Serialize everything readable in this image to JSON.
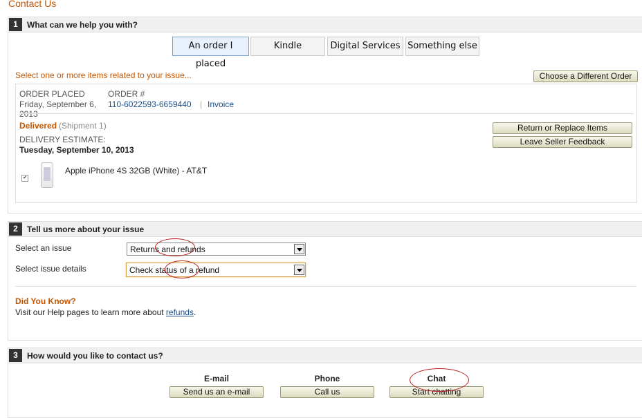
{
  "page_title": "Contact Us",
  "section1": {
    "number": "1",
    "label": "What can we help you with?",
    "tabs": [
      "An order I placed",
      "Kindle",
      "Digital Services",
      "Something else"
    ],
    "select_items_text": "Select one or more items related to your issue...",
    "choose_order_button": "Choose a Different Order",
    "order": {
      "placed_label": "ORDER PLACED",
      "placed_date_line1": "Friday, September 6,",
      "placed_date_line2": "2013",
      "number_label": "ORDER #",
      "number": "110-6022593-6659440",
      "separator": "|",
      "invoice": "Invoice",
      "status": "Delivered",
      "shipment": "(Shipment 1)",
      "delivery_label": "DELIVERY ESTIMATE:",
      "delivery_date": "Tuesday, September 10, 2013",
      "item_name": "Apple iPhone 4S 32GB (White) - AT&T",
      "return_button": "Return or Replace Items",
      "feedback_button": "Leave Seller Feedback"
    }
  },
  "section2": {
    "number": "2",
    "label": "Tell us more about your issue",
    "issue_label": "Select an issue",
    "issue_value": "Returns and refunds",
    "details_label": "Select issue details",
    "details_value": "Check status of a refund",
    "did_you_know_title": "Did You Know?",
    "help_text_prefix": "Visit our Help pages to learn more about ",
    "help_link": "refunds",
    "help_text_suffix": "."
  },
  "section3": {
    "number": "3",
    "label": "How would you like to contact us?",
    "email_title": "E-mail",
    "email_button": "Send us an e-mail",
    "phone_title": "Phone",
    "phone_button": "Call us",
    "chat_title": "Chat",
    "chat_button": "Start chatting"
  },
  "colors": {
    "accent_orange": "#c45500",
    "link_blue": "#1b4f8a",
    "annotation_red": "#b81c1c"
  }
}
